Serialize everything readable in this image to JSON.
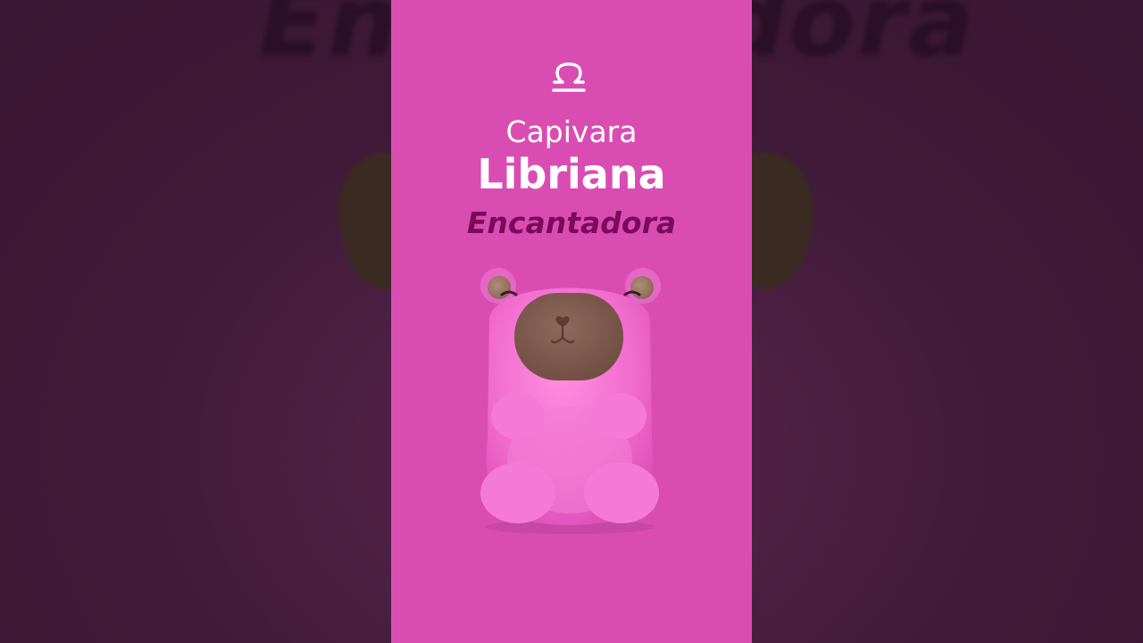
{
  "background": {
    "blurred_text": "Encantadora",
    "colors": {
      "backdrop": "#3f1a38",
      "panel": "#d94db3"
    }
  },
  "header": {
    "icon": "libra-symbol-icon",
    "title_line1": "Capivara",
    "title_line2": "Libriana",
    "subtitle": "Encantadora"
  },
  "mascot": {
    "icon": "pink-capybara-figure",
    "colors": {
      "body": "#f26ccf",
      "snout": "#7d5a4e",
      "ears": "#9c7a68"
    }
  }
}
